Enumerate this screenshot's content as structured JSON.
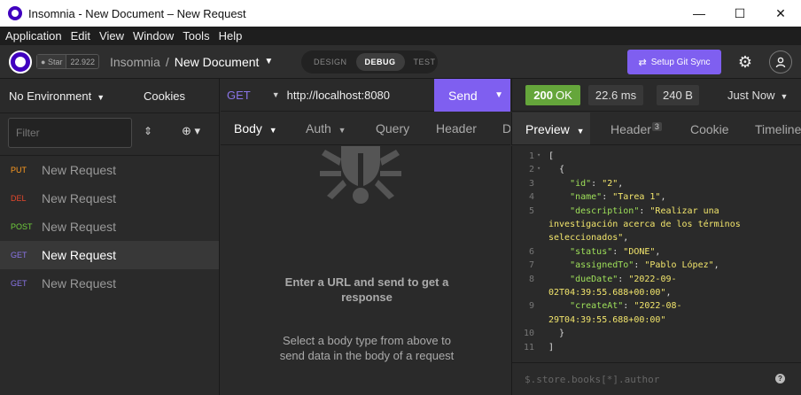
{
  "window": {
    "title": "Insomnia - New Document – New Request",
    "minimize": "—",
    "maximize": "☐",
    "close": "✕"
  },
  "menu": [
    "Application",
    "Edit",
    "View",
    "Window",
    "Tools",
    "Help"
  ],
  "header": {
    "github_star_label": "Star",
    "github_star_count": "22.922",
    "workspace": "Insomnia",
    "separator": "/",
    "document": "New Document",
    "modes": [
      "DESIGN",
      "DEBUG",
      "TEST"
    ],
    "active_mode": "DEBUG",
    "git_sync_label": "Setup Git Sync"
  },
  "sidebar": {
    "environment": "No Environment",
    "cookies": "Cookies",
    "filter_placeholder": "Filter",
    "requests": [
      {
        "method": "PUT",
        "name": "New Request",
        "color": "#ff9a1f"
      },
      {
        "method": "DEL",
        "name": "New Request",
        "color": "#e5482c"
      },
      {
        "method": "POST",
        "name": "New Request",
        "color": "#6fce3c"
      },
      {
        "method": "GET",
        "name": "New Request",
        "color": "#8a75e8"
      },
      {
        "method": "GET",
        "name": "New Request",
        "color": "#8a75e8"
      }
    ],
    "active_index": 3
  },
  "request": {
    "method": "GET",
    "url": "http://localhost:8080",
    "send_label": "Send",
    "tabs": [
      "Body",
      "Auth",
      "Query",
      "Header",
      "Do"
    ],
    "empty_title": "Enter a URL and send to get a response",
    "empty_subtitle": "Select a body type from above to send data in the body of a request"
  },
  "response": {
    "status_code": "200",
    "status_text": "OK",
    "time": "22.6 ms",
    "size": "240 B",
    "timestamp": "Just Now",
    "tabs": [
      "Preview",
      "Header",
      "Cookie",
      "Timeline"
    ],
    "header_count": "3",
    "filter_placeholder": "$.store.books[*].author",
    "help": "?",
    "lines": [
      {
        "n": "1",
        "fold": "▾",
        "code": [
          [
            "p",
            "["
          ]
        ]
      },
      {
        "n": "2",
        "fold": "▾",
        "code": [
          [
            "p",
            "  {"
          ]
        ]
      },
      {
        "n": "3",
        "fold": "",
        "code": [
          [
            "k",
            "    \"id\""
          ],
          [
            "p",
            ": "
          ],
          [
            "s",
            "\"2\""
          ],
          [
            "p",
            ","
          ]
        ]
      },
      {
        "n": "4",
        "fold": "",
        "code": [
          [
            "k",
            "    \"name\""
          ],
          [
            "p",
            ": "
          ],
          [
            "s",
            "\"Tarea 1\""
          ],
          [
            "p",
            ","
          ]
        ]
      },
      {
        "n": "5",
        "fold": "",
        "code": [
          [
            "k",
            "    \"description\""
          ],
          [
            "p",
            ": "
          ],
          [
            "s",
            "\"Realizar una"
          ]
        ]
      },
      {
        "n": "",
        "fold": "",
        "code": [
          [
            "s",
            "investigación acerca de los términos"
          ]
        ]
      },
      {
        "n": "",
        "fold": "",
        "code": [
          [
            "s",
            "seleccionados\""
          ],
          [
            "p",
            ","
          ]
        ]
      },
      {
        "n": "6",
        "fold": "",
        "code": [
          [
            "k",
            "    \"status\""
          ],
          [
            "p",
            ": "
          ],
          [
            "s",
            "\"DONE\""
          ],
          [
            "p",
            ","
          ]
        ]
      },
      {
        "n": "7",
        "fold": "",
        "code": [
          [
            "k",
            "    \"assignedTo\""
          ],
          [
            "p",
            ": "
          ],
          [
            "s",
            "\"Pablo López\""
          ],
          [
            "p",
            ","
          ]
        ]
      },
      {
        "n": "8",
        "fold": "",
        "code": [
          [
            "k",
            "    \"dueDate\""
          ],
          [
            "p",
            ": "
          ],
          [
            "s",
            "\"2022-09-"
          ]
        ]
      },
      {
        "n": "",
        "fold": "",
        "code": [
          [
            "s",
            "02T04:39:55.688+00:00\""
          ],
          [
            "p",
            ","
          ]
        ]
      },
      {
        "n": "9",
        "fold": "",
        "code": [
          [
            "k",
            "    \"createAt\""
          ],
          [
            "p",
            ": "
          ],
          [
            "s",
            "\"2022-08-"
          ]
        ]
      },
      {
        "n": "",
        "fold": "",
        "code": [
          [
            "s",
            "29T04:39:55.688+00:00\""
          ]
        ]
      },
      {
        "n": "10",
        "fold": "",
        "code": [
          [
            "p",
            "  }"
          ]
        ]
      },
      {
        "n": "11",
        "fold": "",
        "code": [
          [
            "p",
            "]"
          ]
        ]
      }
    ]
  }
}
